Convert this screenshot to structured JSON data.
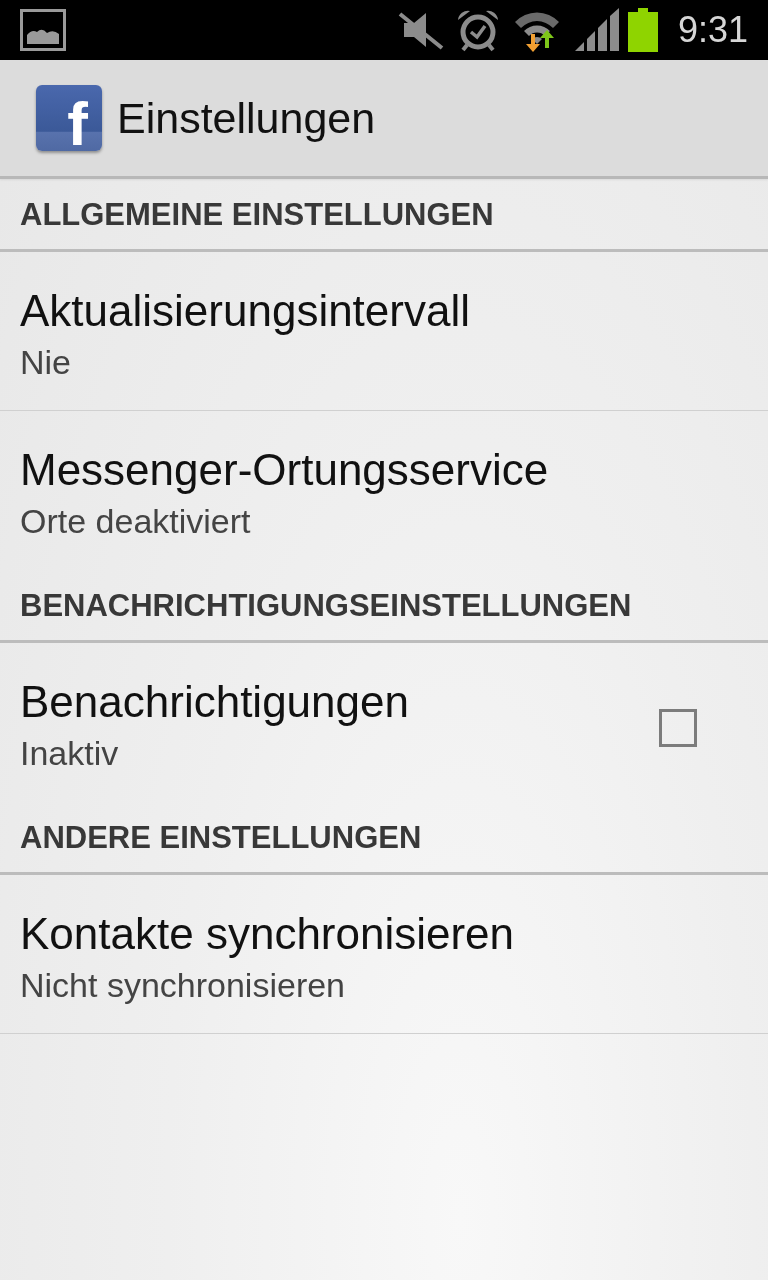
{
  "status_bar": {
    "time": "9:31"
  },
  "action_bar": {
    "logo_letter": "f",
    "title": "Einstellungen"
  },
  "sections": [
    {
      "header": "ALLGEMEINE EINSTELLUNGEN",
      "items": [
        {
          "kind": "plain",
          "title": "Aktualisierungsintervall",
          "summary": "Nie"
        },
        {
          "kind": "plain",
          "title": "Messenger-Ortungsservice",
          "summary": "Orte deaktiviert"
        }
      ]
    },
    {
      "header": "BENACHRICHTIGUNGSEINSTELLUNGEN",
      "items": [
        {
          "kind": "checkbox",
          "title": "Benachrichtigungen",
          "summary": "Inaktiv",
          "checked": false
        }
      ]
    },
    {
      "header": "ANDERE EINSTELLUNGEN",
      "items": [
        {
          "kind": "plain",
          "title": "Kontakte synchronisieren",
          "summary": "Nicht synchronisieren"
        }
      ]
    }
  ]
}
